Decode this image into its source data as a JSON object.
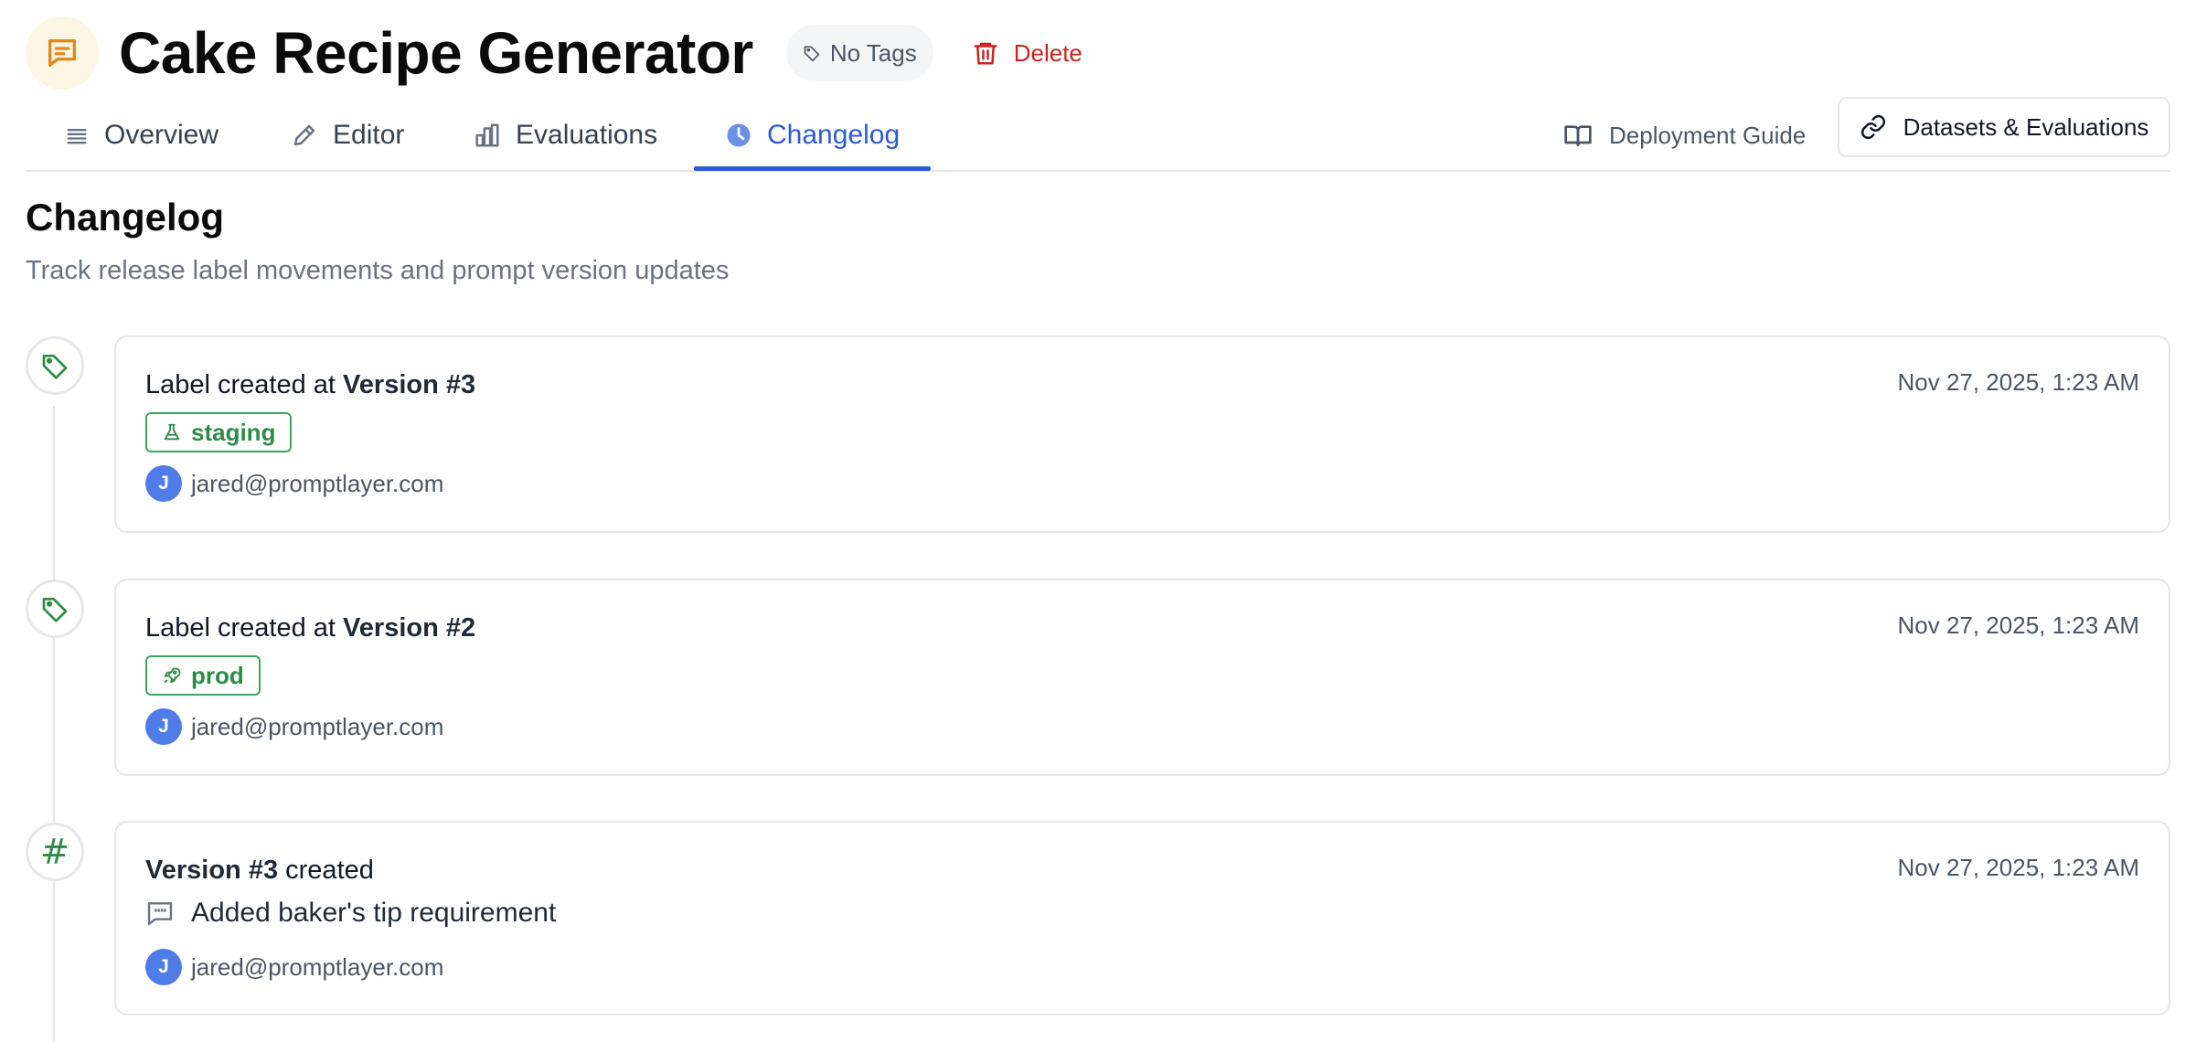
{
  "header": {
    "title": "Cake Recipe Generator",
    "tags_label": "No Tags",
    "delete_label": "Delete"
  },
  "tabs": [
    {
      "label": "Overview",
      "icon": "list-icon",
      "active": false
    },
    {
      "label": "Editor",
      "icon": "pencil-icon",
      "active": false
    },
    {
      "label": "Evaluations",
      "icon": "bar-chart-icon",
      "active": false
    },
    {
      "label": "Changelog",
      "icon": "clock-icon",
      "active": true
    }
  ],
  "actions": {
    "deployment_guide": "Deployment Guide",
    "datasets_evaluations": "Datasets & Evaluations"
  },
  "section": {
    "title": "Changelog",
    "subtitle": "Track release label movements and prompt version updates"
  },
  "entries": [
    {
      "type": "label",
      "heading_prefix": "Label created at ",
      "heading_strong": "Version #3",
      "timestamp": "Nov 27, 2025, 1:23 AM",
      "badge": "staging",
      "badge_icon": "flask-icon",
      "user_initial": "J",
      "user_email": "jared@promptlayer.com"
    },
    {
      "type": "label",
      "heading_prefix": "Label created at ",
      "heading_strong": "Version #2",
      "timestamp": "Nov 27, 2025, 1:23 AM",
      "badge": "prod",
      "badge_icon": "rocket-icon",
      "user_initial": "J",
      "user_email": "jared@promptlayer.com"
    },
    {
      "type": "version",
      "heading_strong": "Version #3",
      "heading_suffix": " created",
      "timestamp": "Nov 27, 2025, 1:23 AM",
      "message": "Added baker's tip requirement",
      "user_initial": "J",
      "user_email": "jared@promptlayer.com"
    }
  ],
  "colors": {
    "accent": "#2D5BD8",
    "danger": "#C8231E",
    "success": "#2E8B47",
    "avatar": "#4F7CE8",
    "prompt_icon": "#E08A1E"
  }
}
